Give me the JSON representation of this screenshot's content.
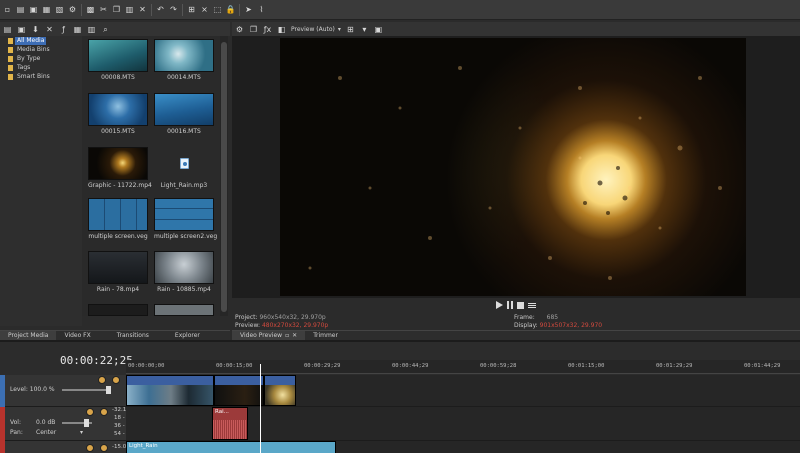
{
  "toolbar": {
    "icons": [
      "new-icon",
      "open-icon",
      "save-icon",
      "save-as-icon",
      "properties-icon",
      "settings-icon",
      "render-icon",
      "cut-icon",
      "copy-icon",
      "paste-icon",
      "delete-icon",
      "undo-icon",
      "redo-icon",
      "snap-icon",
      "auto-crossfade-icon",
      "ripple-icon",
      "lock-envelope-icon",
      "cursor-tool-icon",
      "split-tool-icon"
    ]
  },
  "media_panel": {
    "tree": [
      "All Media",
      "Media Bins",
      "By Type",
      "Tags",
      "Smart Bins"
    ],
    "items": [
      {
        "name": "00008.MTS",
        "icon": "video-thumbnail"
      },
      {
        "name": "00014.MTS",
        "icon": "video-thumbnail"
      },
      {
        "name": "00015.MTS",
        "icon": "video-thumbnail"
      },
      {
        "name": "00016.MTS",
        "icon": "video-thumbnail"
      },
      {
        "name": "Graphic - 11722.mp4",
        "icon": "video-thumbnail"
      },
      {
        "name": "Light_Rain.mp3",
        "icon": "audio-file-icon"
      },
      {
        "name": "multiple screen.veg",
        "icon": "project-thumbnail"
      },
      {
        "name": "multiple screen2.veg",
        "icon": "project-thumbnail"
      },
      {
        "name": "Rain - 78.mp4",
        "icon": "video-thumbnail"
      },
      {
        "name": "Rain - 10885.mp4",
        "icon": "video-thumbnail"
      }
    ],
    "tabs": [
      "Project Media",
      "Video FX",
      "Transitions",
      "Explorer"
    ]
  },
  "preview": {
    "mode": "Preview (Auto)",
    "info": {
      "project_label": "Project:",
      "project_value": "960x540x32, 29.970p",
      "preview_label": "Preview:",
      "preview_value": "480x270x32, 29.970p",
      "frame_label": "Frame:",
      "frame_value": "685",
      "display_label": "Display:",
      "display_value": "901x507x32, 29.970"
    },
    "tabs": [
      "Video Preview",
      "Trimmer"
    ]
  },
  "timeline": {
    "timecode": "00:00:22;25",
    "ruler": [
      "00:00:00;00",
      "00:00:15;00",
      "00:00:29;29",
      "00:00:44;29",
      "00:00:59;28",
      "00:01:15;00",
      "00:01:29;29",
      "00:01:44;29"
    ],
    "video_track": {
      "level_label": "Level: 100.0 %"
    },
    "audio_track": {
      "vol_label": "Vol:",
      "vol_value": "0.0 dB",
      "pan_label": "Pan:",
      "pan_value": "Center",
      "meter_values": [
        "-32.1",
        "18 -",
        "36 -",
        "54 -",
        "-15.0"
      ]
    },
    "clips": {
      "audio_clip_label": "Rai...",
      "music_clip_label": "Light_Rain"
    }
  },
  "colors": {
    "accent_blue": "#3d6db5",
    "audio_red": "#b8332d",
    "info_red": "#d24a3e",
    "music_clip": "#5aa7c8"
  }
}
